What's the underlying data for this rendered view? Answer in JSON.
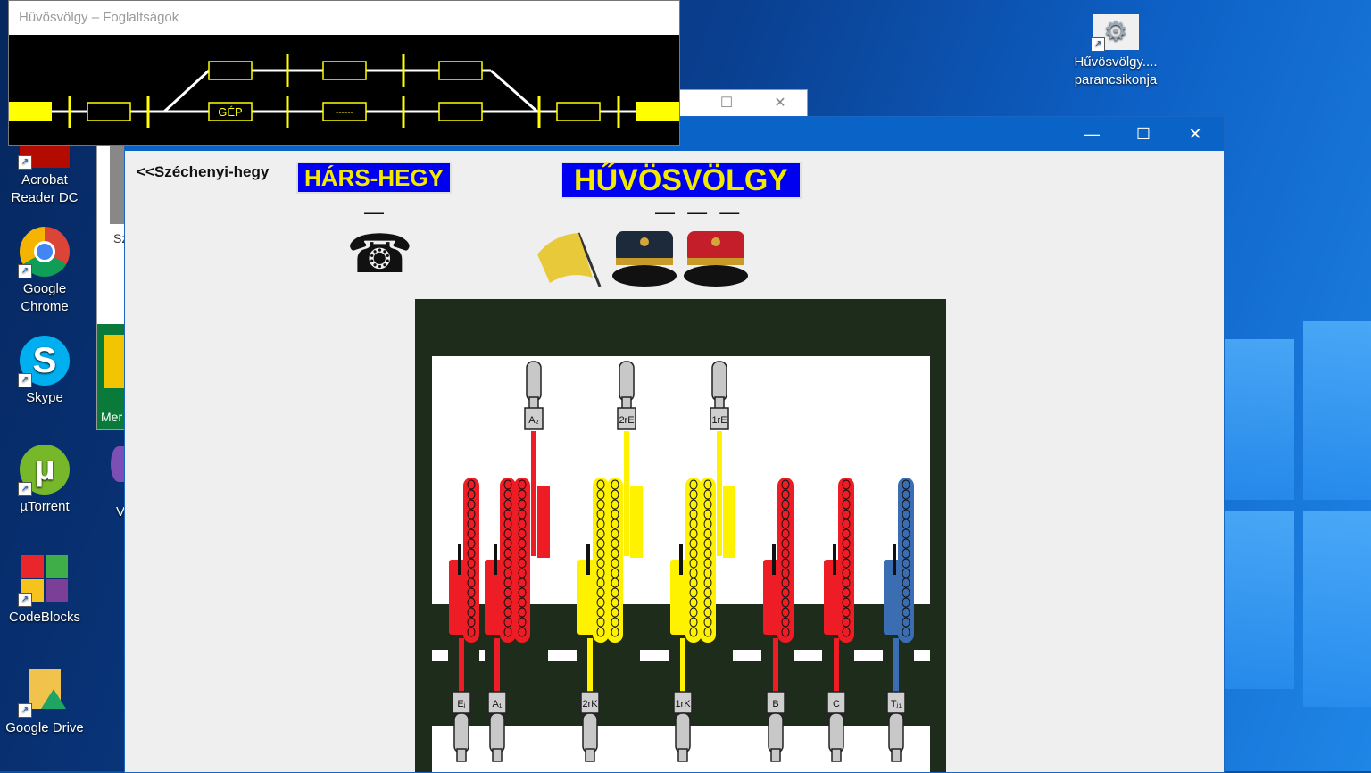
{
  "desktop": {
    "icons": [
      {
        "label_line1": "Acrobat",
        "label_line2": "Reader DC"
      },
      {
        "label_line1": "Google",
        "label_line2": "Chrome"
      },
      {
        "label_line1": "Skype",
        "label_line2": ""
      },
      {
        "label_line1": "µTorrent",
        "label_line2": ""
      },
      {
        "label_line1": "CodeBlocks",
        "label_line2": ""
      },
      {
        "label_line1": "Google Drive",
        "label_line2": ""
      },
      {
        "label_line1": "Hűvösvölgy....",
        "label_line2": "parancsikonja"
      }
    ],
    "partial_labels": {
      "sz": "Sz",
      "mer": "Mer",
      "v": "V"
    }
  },
  "occupancy_window": {
    "title": "Hűvösvölgy – Foglaltságok",
    "track_labels": {
      "gep": "GÉP",
      "dashes": "------"
    }
  },
  "main_window": {
    "caption": {
      "minimize": "—",
      "maximize": "☐",
      "close": "✕"
    },
    "left_link": "<<Széchenyi-hegy",
    "prev_station": "HÁRS-HEGY",
    "current_station": "HŰVÖSVÖLGY",
    "prev_dash": "—",
    "cur_dash": "— — —",
    "phone_glyph": "☎",
    "levers_top": [
      {
        "label": "A₂",
        "color": "red"
      },
      {
        "label": "2rE",
        "color": "yellow"
      },
      {
        "label": "1rE",
        "color": "yellow"
      }
    ],
    "levers_bottom": [
      {
        "label": "Eⱼ",
        "color": "red"
      },
      {
        "label": "A₁",
        "color": "red"
      },
      {
        "label": "2rK",
        "color": "yellow"
      },
      {
        "label": "1rK",
        "color": "yellow"
      },
      {
        "label": "B",
        "color": "red"
      },
      {
        "label": "C",
        "color": "red"
      },
      {
        "label": "Tⱼ₁",
        "color": "blue"
      }
    ]
  },
  "colors": {
    "lever_red": "#ee1c24",
    "lever_yellow": "#fff200",
    "lever_blue": "#3b6db3",
    "frame_green": "#1e2d1b",
    "station_blue": "#0000f0",
    "station_text": "#f2e900"
  }
}
